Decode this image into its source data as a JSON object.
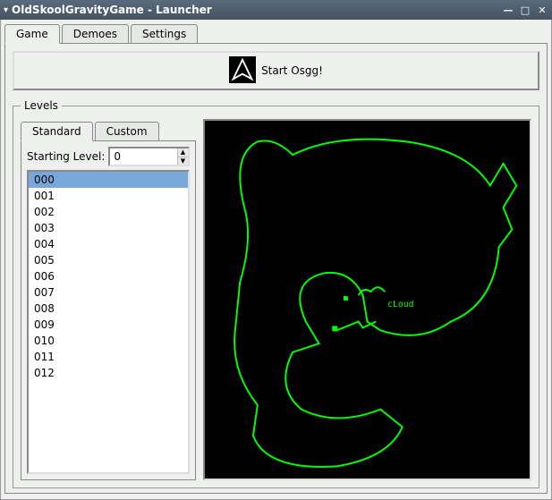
{
  "window": {
    "title": "OldSkoolGravityGame - Launcher"
  },
  "tabs": {
    "game": "Game",
    "demoes": "Demoes",
    "settings": "Settings"
  },
  "start": {
    "label": "Start Osgg!"
  },
  "levels": {
    "legend": "Levels",
    "subtabs": {
      "standard": "Standard",
      "custom": "Custom"
    },
    "starting_label": "Starting Level:",
    "starting_value": "0",
    "items": [
      "000",
      "001",
      "002",
      "003",
      "004",
      "005",
      "006",
      "007",
      "008",
      "009",
      "010",
      "011",
      "012"
    ],
    "selected_index": 0,
    "preview_label": "cLoud"
  },
  "colors": {
    "map_stroke": "#00ff00"
  }
}
